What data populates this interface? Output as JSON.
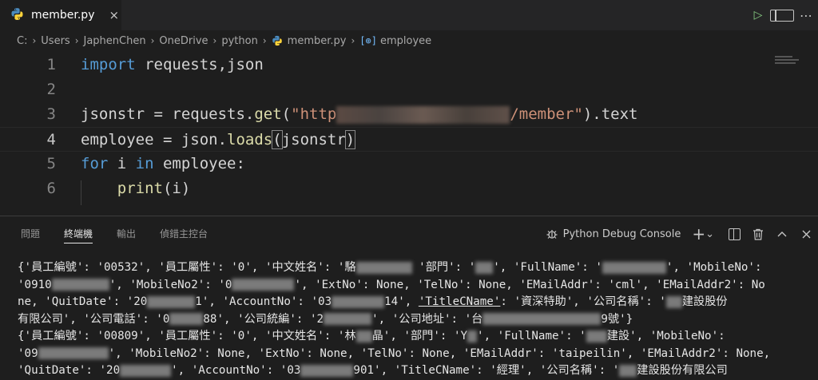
{
  "tab": {
    "file_name": "member.py",
    "close": "×"
  },
  "breadcrumb": {
    "items": [
      "C:",
      "Users",
      "JaphenChen",
      "OneDrive",
      "python",
      "member.py",
      "employee"
    ],
    "sep": "›"
  },
  "code": {
    "line_numbers": [
      "1",
      "2",
      "3",
      "4",
      "5",
      "6"
    ],
    "l1_kw": "import",
    "l1_rest": " requests,json",
    "l3_a": "jsonstr = requests.",
    "l3_fn": "get",
    "l3_b": "(",
    "l3_str1": "\"http",
    "l3_str2": "/member\"",
    "l3_c": ").text",
    "l4_a": "employee = json.",
    "l4_fn": "loads",
    "l4_paren_open": "(",
    "l4_arg": "jsonstr",
    "l4_paren_close": ")",
    "l5_kw1": "for",
    "l5_a": " i ",
    "l5_kw2": "in",
    "l5_b": " employee:",
    "l6_indent": "    ",
    "l6_fn": "print",
    "l6_rest": "(i)"
  },
  "panel": {
    "tabs": [
      "問題",
      "終端機",
      "輸出",
      "偵錯主控台"
    ],
    "active_tab": "終端機",
    "console_label": "Python Debug Console",
    "add": "+",
    "chevron": "⌄"
  },
  "terminal": {
    "l1a": "{'員工編號': '00532', '員工屬性': '0', '中文姓名': '駱",
    "l1b": " '部門': '",
    "l1c": "', 'FullName': '",
    "l1d": "', 'MobileNo':",
    "l2a": "'0910",
    "l2b": "', 'MobileNo2': '0",
    "l2c": "', 'ExtNo': None, 'TelNo': None, 'EMailAddr': 'cml', 'EMailAddr2': No",
    "l3a": "ne, 'QuitDate': '20",
    "l3b": "1', 'AccountNo': '03",
    "l3c": "14', ",
    "l3d": "'TitleCName'",
    "l3e": ": '資深特助', '公司名稱': '",
    "l3f": "建設股份",
    "l4a": "有限公司', '公司電話': '0",
    "l4b": "88', '公司統編': '2",
    "l4c": "', '公司地址': '台",
    "l4d": "9號'}",
    "l5a": "{'員工編號': '00809', '員工屬性': '0', '中文姓名': '林",
    "l5b": "晶', '部門': 'Y",
    "l5c": "', 'FullName': '",
    "l5d": "建設', 'MobileNo':",
    "l6a": "'09",
    "l6b": "', 'MobileNo2': None, 'ExtNo': None, 'TelNo': None, 'EMailAddr': 'taipeilin', 'EMailAddr2': None,",
    "l7a": "'QuitDate': '20",
    "l7b": "', 'AccountNo': '03",
    "l7c": "901', 'TitleCName': '經理', '公司名稱': '",
    "l7d": "建設股份有限公司"
  }
}
